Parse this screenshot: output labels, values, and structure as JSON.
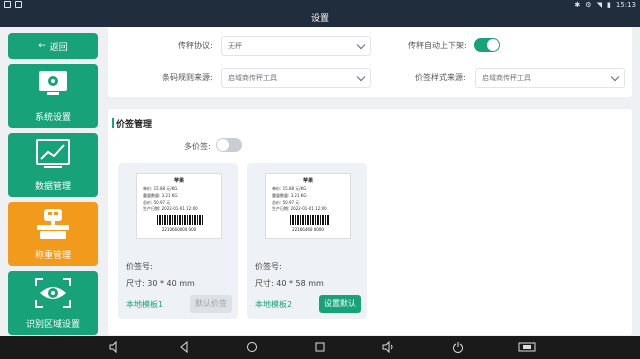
{
  "status_bar": {
    "time": "15:13"
  },
  "title": "设置",
  "sidebar": {
    "back_label": "返回",
    "items": [
      {
        "label": "系统设置",
        "icon": "gear-monitor-icon",
        "active": false
      },
      {
        "label": "数据管理",
        "icon": "chart-icon",
        "active": false
      },
      {
        "label": "称重管理",
        "icon": "scale-icon",
        "active": true
      },
      {
        "label": "识别区域设置",
        "icon": "eye-icon",
        "active": false
      }
    ]
  },
  "scale_settings": {
    "protocol_label": "传秤协议:",
    "protocol_value": "无秤",
    "auto_label": "传秤自动上下架:",
    "auto_on": true,
    "barcode_rule_label": "条码规则来源:",
    "barcode_rule_value": "启域商传秤工具",
    "label_style_label": "价签样式来源:",
    "label_style_value": "启域商传秤工具"
  },
  "price_tag": {
    "section_title": "价签管理",
    "multi_label": "多价签:",
    "multi_on": false,
    "cards": [
      {
        "preview": {
          "name": "苹果",
          "lines": [
            "单价:   15.88  元/KG",
            "重量数量: 3.21       KG",
            "总价:   50.97  元",
            "生产日期: 2022-01-01 12:00"
          ],
          "barcode_number": "2210660000 000"
        },
        "tag_no_label": "价签号:",
        "size_text": "尺寸: 30 * 40 mm",
        "template_label": "本地模板1",
        "button_label": "默认价签",
        "button_state": "disabled"
      },
      {
        "preview": {
          "name": "苹果",
          "lines": [
            "单价:    15.88  元/KG",
            "重量数量:  3.21       KG",
            "总价:    50.97  元",
            "生产日期: 2022-01-01 12:00"
          ],
          "barcode_number": "22166460 0000"
        },
        "tag_no_label": "价签号:",
        "size_text": "尺寸: 40 * 58 mm",
        "template_label": "本地模板2",
        "button_label": "设置默认",
        "button_state": "primary"
      }
    ]
  }
}
